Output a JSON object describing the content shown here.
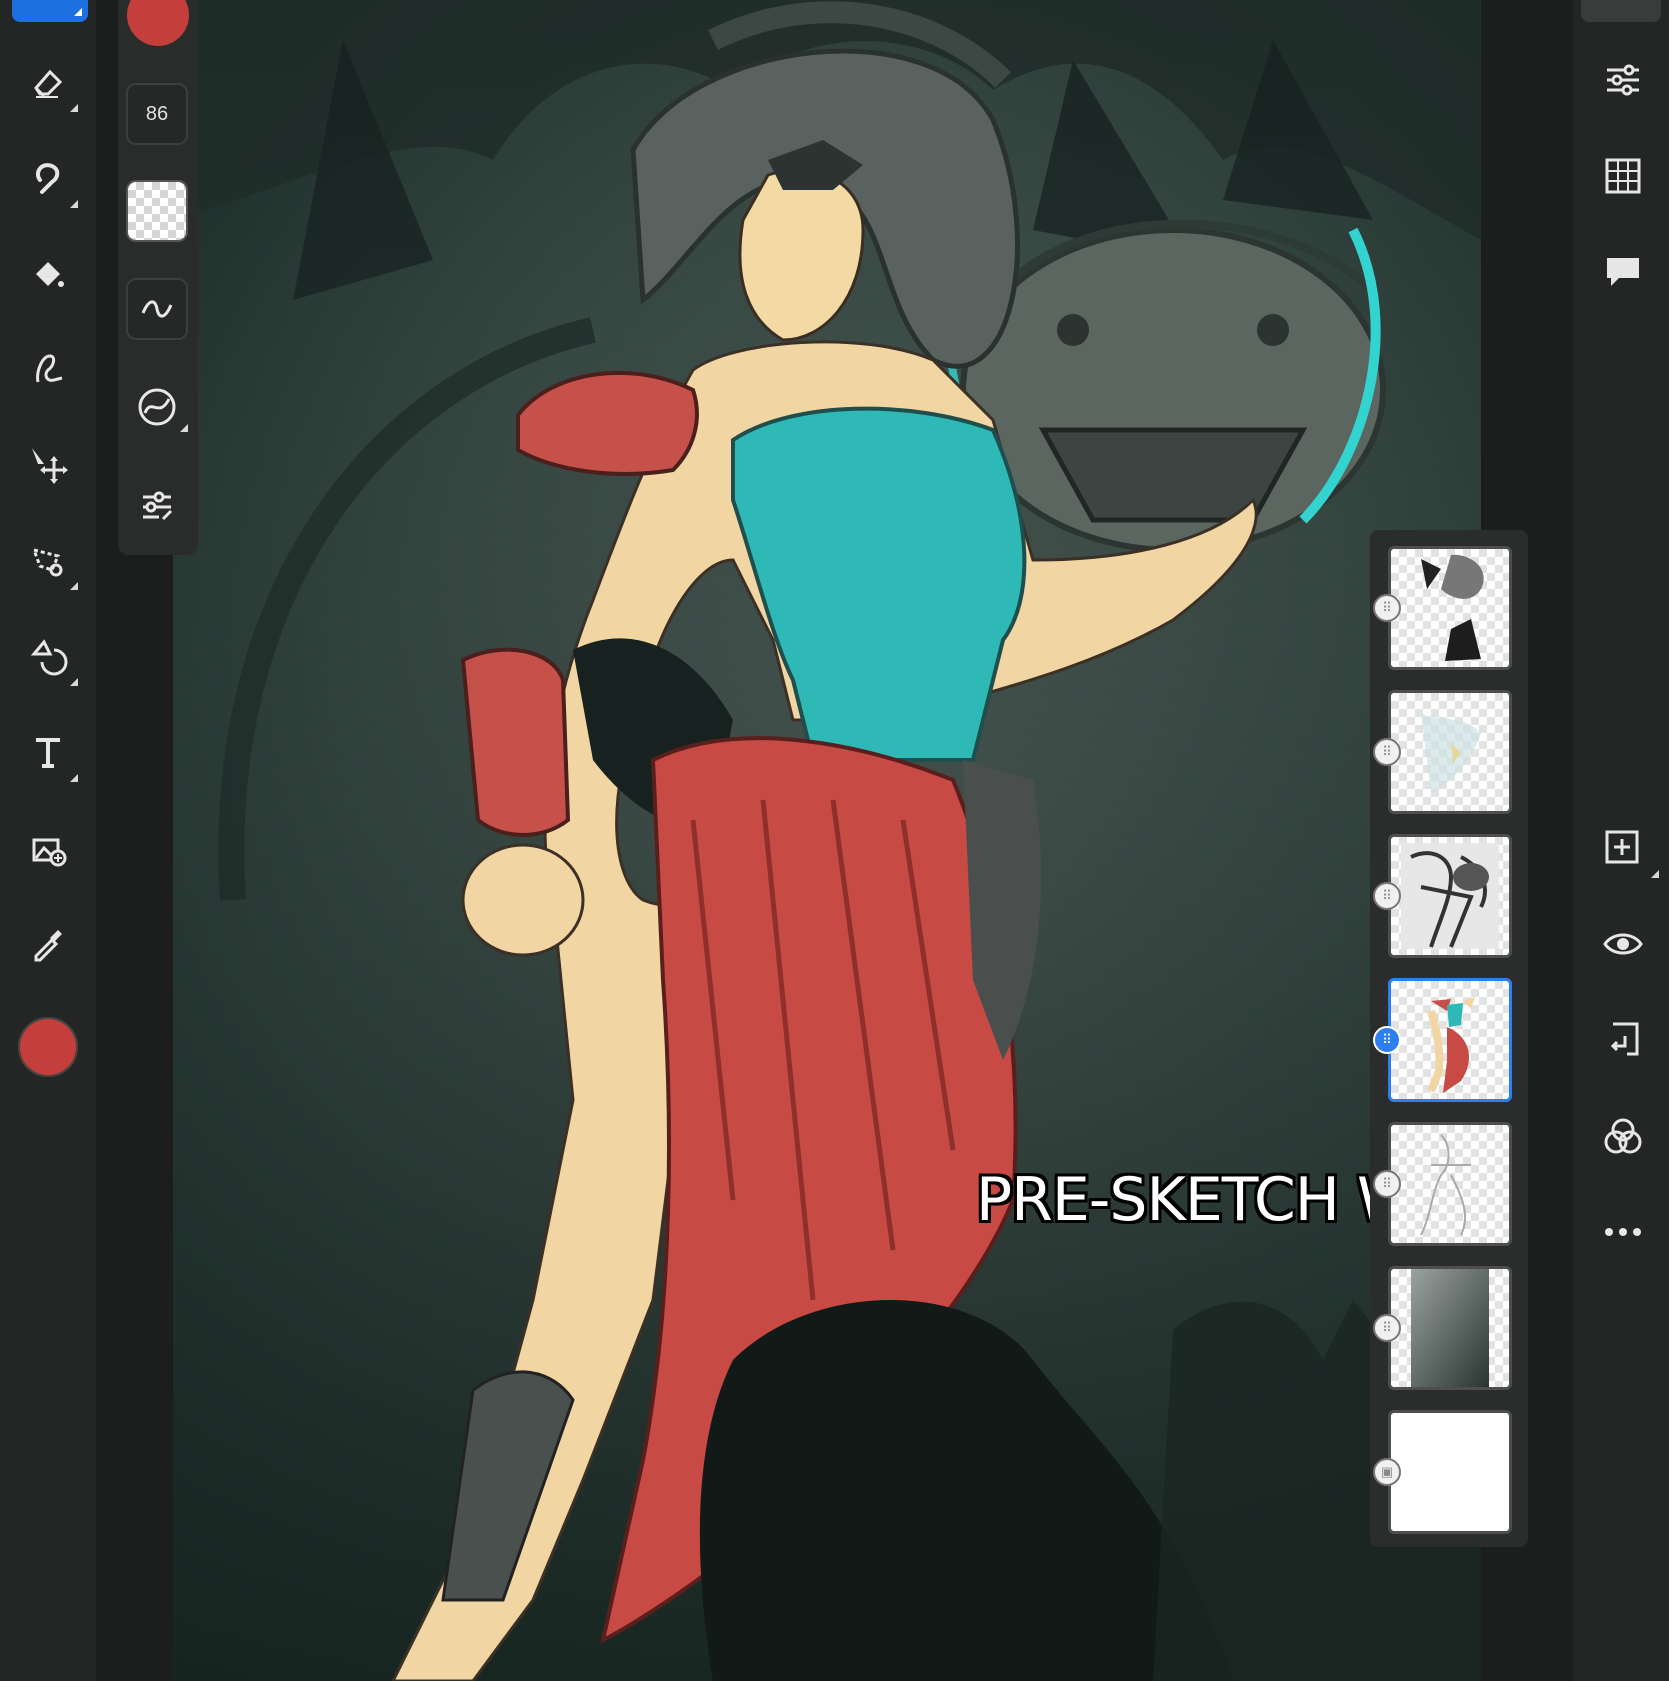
{
  "brush": {
    "size": "86"
  },
  "caption": "PRE-SKETCH WIP",
  "colors": {
    "current_color": "#c43f3b",
    "accent": "#1e6fe0",
    "selected_layer_border": "#2d7ff0"
  },
  "left_toolbar": {
    "tools": [
      {
        "name": "brush-tool",
        "icon": "brush-icon",
        "active": true
      },
      {
        "name": "eraser-tool",
        "icon": "eraser-icon"
      },
      {
        "name": "smudge-tool",
        "icon": "smudge-icon"
      },
      {
        "name": "fill-tool",
        "icon": "paint-bucket-icon"
      },
      {
        "name": "liquify-tool",
        "icon": "liquify-icon"
      },
      {
        "name": "move-tool",
        "icon": "move-icon"
      },
      {
        "name": "selection-tool",
        "icon": "lasso-icon"
      },
      {
        "name": "transform-tool",
        "icon": "transform-icon"
      },
      {
        "name": "text-tool",
        "icon": "text-icon"
      },
      {
        "name": "add-image-tool",
        "icon": "add-image-icon"
      },
      {
        "name": "eyedropper-tool",
        "icon": "eyedropper-icon"
      }
    ]
  },
  "brush_panel": {
    "items": [
      "brush-color-swatch",
      "brush-size",
      "opacity-swatch",
      "smoothing-icon",
      "predictive-stroke-icon",
      "brush-settings-icon"
    ]
  },
  "right_toolbar": {
    "tools": [
      "properties-icon",
      "grid-icon",
      "comments-icon",
      "add-layer-icon",
      "visibility-icon",
      "export-icon",
      "blend-modes-icon",
      "more-icon"
    ]
  },
  "layers": [
    {
      "name": "layer-1",
      "selected": false
    },
    {
      "name": "layer-2",
      "selected": false
    },
    {
      "name": "layer-3",
      "selected": false
    },
    {
      "name": "layer-4",
      "selected": true
    },
    {
      "name": "layer-5",
      "selected": false
    },
    {
      "name": "layer-6",
      "selected": false
    },
    {
      "name": "layer-7",
      "selected": false
    }
  ]
}
